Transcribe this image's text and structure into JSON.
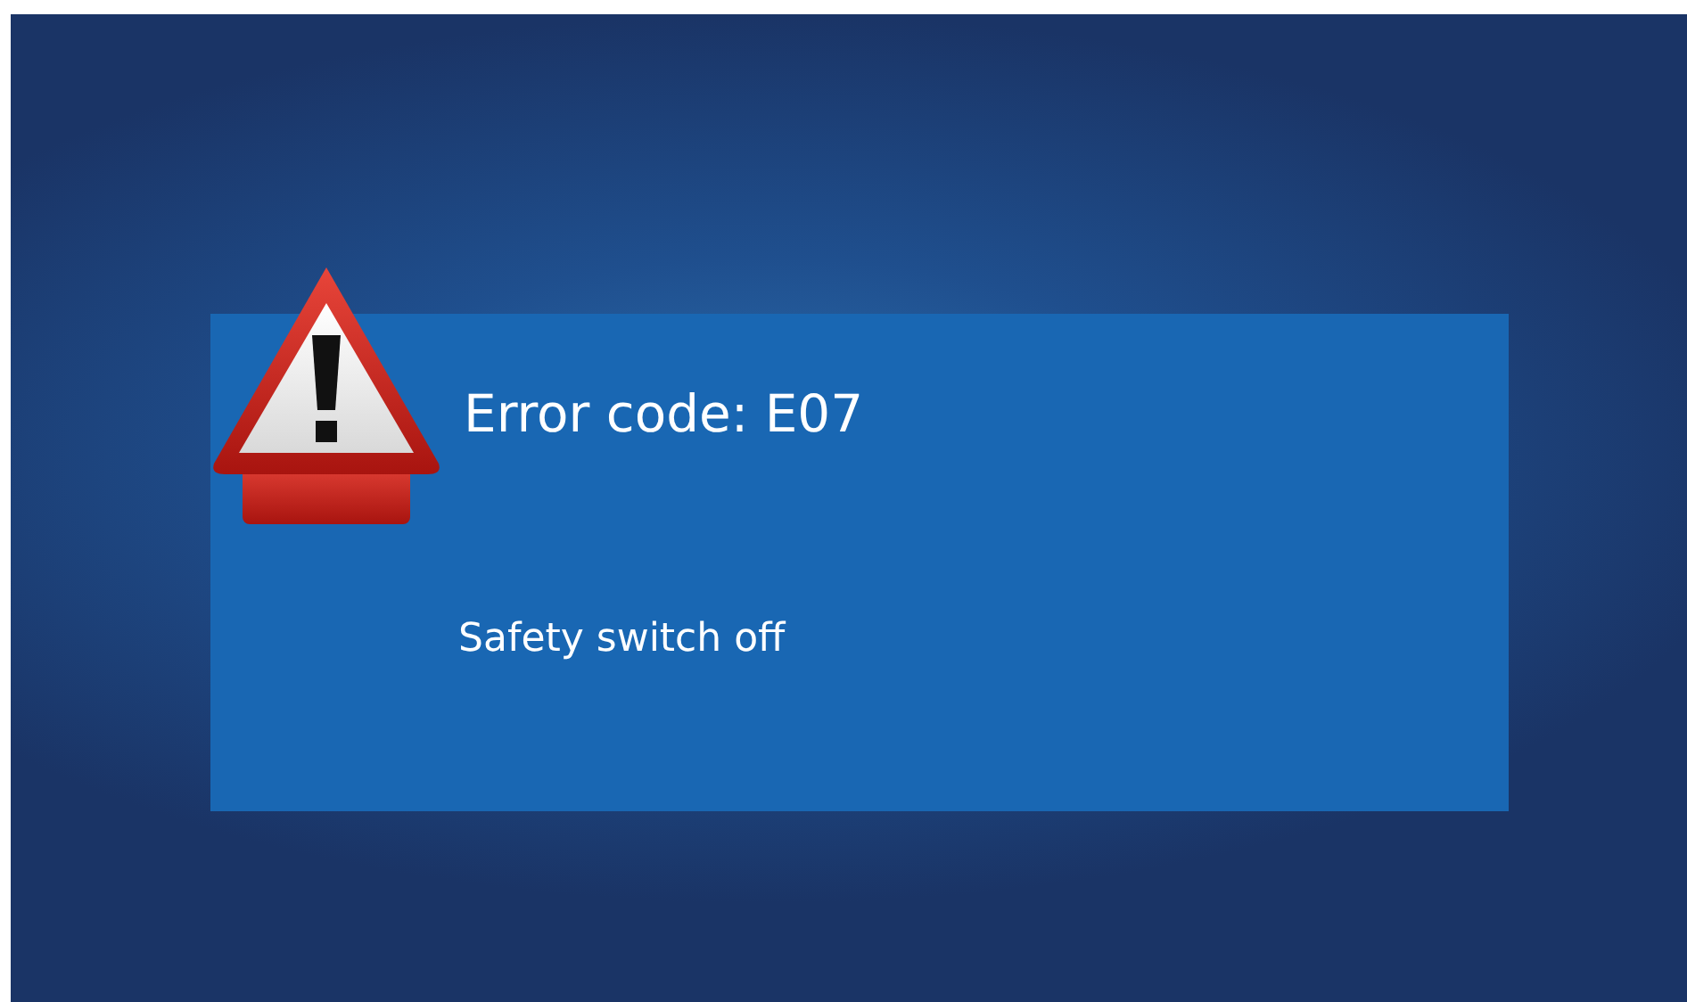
{
  "dialog": {
    "title": "Error code: E07",
    "message": "Safety switch off"
  }
}
